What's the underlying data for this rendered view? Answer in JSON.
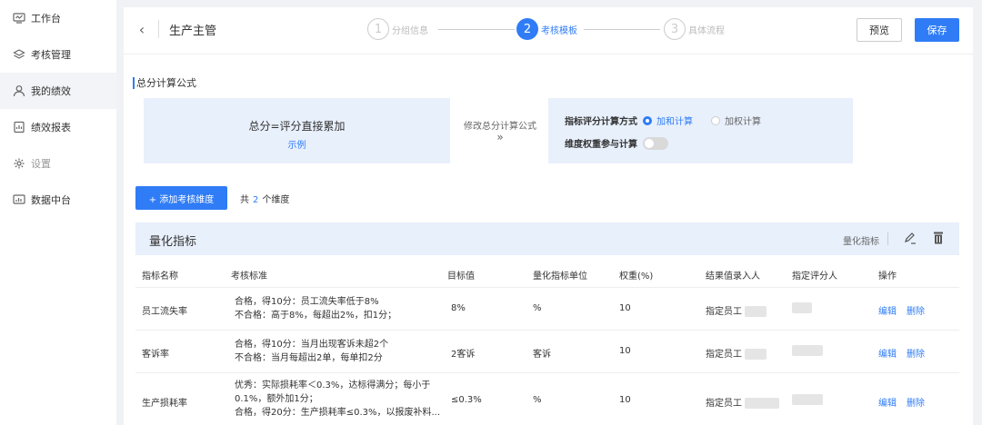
{
  "sidebar": {
    "items": [
      {
        "label": "工作台",
        "icon": "monitor-icon"
      },
      {
        "label": "考核管理",
        "icon": "layers-icon"
      },
      {
        "label": "我的绩效",
        "icon": "user-icon"
      },
      {
        "label": "绩效报表",
        "icon": "report-icon"
      },
      {
        "label": "设置",
        "icon": "gear-icon"
      },
      {
        "label": "数据中台",
        "icon": "chart-icon"
      }
    ]
  },
  "header": {
    "back": "‹",
    "title": "生产主管",
    "steps": [
      {
        "num": "1",
        "label": "分组信息",
        "state": "todo"
      },
      {
        "num": "2",
        "label": "考核模板",
        "state": "current"
      },
      {
        "num": "3",
        "label": "具体流程",
        "state": "todo"
      }
    ],
    "preview_label": "预览",
    "save_label": "保存"
  },
  "formula": {
    "section_title": "总分计算公式",
    "text": "总分=评分直接累加",
    "example_link": "示例",
    "modify_label": "修改总分计算公式",
    "modify_arrow": "»",
    "calc_method_label": "指标评分计算方式",
    "option_sum": "加和计算",
    "option_weighted": "加权计算",
    "weight_label": "维度权重参与计算"
  },
  "dimension": {
    "add_label": "+ 添加考核维度",
    "count_prefix": "共",
    "count": "2",
    "count_suffix": "个维度"
  },
  "table": {
    "card_title": "量化指标",
    "card_tag": "量化指标",
    "headers": [
      "指标名称",
      "考核标准",
      "目标值",
      "量化指标单位",
      "权重(%)",
      "结果值录入人",
      "指定评分人",
      "操作"
    ],
    "rows": [
      {
        "name": "员工流失率",
        "std": [
          "合格，得10分：员工流失率低于8%",
          "不合格：高于8%，每超出2%，扣1分；"
        ],
        "target": "8%",
        "unit": "%",
        "weight": "10",
        "recorder": "指定员工",
        "edit": "编辑",
        "delete": "删除"
      },
      {
        "name": "客诉率",
        "std": [
          "合格，得10分：当月出现客诉未超2个",
          "不合格：当月每超出2单，每单扣2分"
        ],
        "target": "2客诉",
        "unit": "客诉",
        "weight": "10",
        "recorder": "指定员工",
        "edit": "编辑",
        "delete": "删除"
      },
      {
        "name": "生产损耗率",
        "std": [
          "优秀：实际损耗率＜0.3%，达标得满分；每小于",
          "0.1%，额外加1分；",
          "合格，得20分：生产损耗率≤0.3%，以报废补料..."
        ],
        "target": "≤0.3%",
        "unit": "%",
        "weight": "10",
        "recorder": "指定员工",
        "edit": "编辑",
        "delete": "删除"
      }
    ]
  },
  "colors": {
    "accent": "#2f7cf6",
    "panel": "#e8f0fc"
  }
}
